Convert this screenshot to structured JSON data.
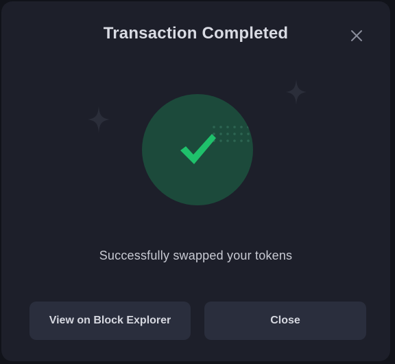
{
  "modal": {
    "title": "Transaction Completed",
    "close_icon": "close-icon",
    "status_icon": "checkmark-icon",
    "message": "Successfully swapped your tokens"
  },
  "actions": {
    "explorer_label": "View on Block Explorer",
    "close_label": "Close"
  },
  "colors": {
    "modal_background": "#1d1f2a",
    "success_circle": "#1c4a3b",
    "success_check": "#1fc16b",
    "button_background": "#2a2e3d"
  }
}
